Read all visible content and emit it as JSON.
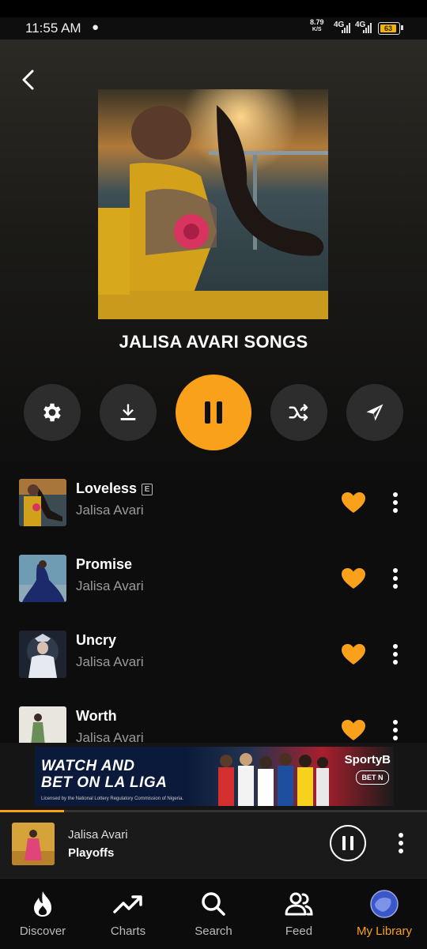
{
  "status_bar": {
    "time": "11:55 AM",
    "net_speed": "8.79",
    "net_unit": "K/S",
    "signal1": "4G",
    "signal2": "4G",
    "battery": "63"
  },
  "playlist": {
    "title": "JALISA AVARI SONGS"
  },
  "controls": [
    "settings",
    "download",
    "pause",
    "shuffle",
    "share"
  ],
  "songs": [
    {
      "title": "Loveless",
      "artist": "Jalisa Avari",
      "explicit": "E"
    },
    {
      "title": "Promise",
      "artist": "Jalisa Avari"
    },
    {
      "title": "Uncry",
      "artist": "Jalisa Avari"
    },
    {
      "title": "Worth",
      "artist": "Jalisa Avari"
    }
  ],
  "ad": {
    "headline_line1": "WATCH AND",
    "headline_line2": "BET ON LA LIGA",
    "brand": "SportyB",
    "cta": "BET N",
    "fine_print": "Licensed by the National Lottery Regulatory Commission of Nigeria."
  },
  "mini_player": {
    "artist": "Jalisa Avari",
    "track": "Playoffs",
    "progress_fraction": 0.15
  },
  "nav": [
    {
      "label": "Discover",
      "icon": "flame-icon"
    },
    {
      "label": "Charts",
      "icon": "trending-icon"
    },
    {
      "label": "Search",
      "icon": "search-icon"
    },
    {
      "label": "Feed",
      "icon": "people-icon"
    },
    {
      "label": "My Library",
      "icon": "avatar-icon",
      "active": true
    }
  ],
  "colors": {
    "accent": "#f9a11b",
    "background": "#0d0d0d",
    "muted_text": "#9a9a9a"
  }
}
